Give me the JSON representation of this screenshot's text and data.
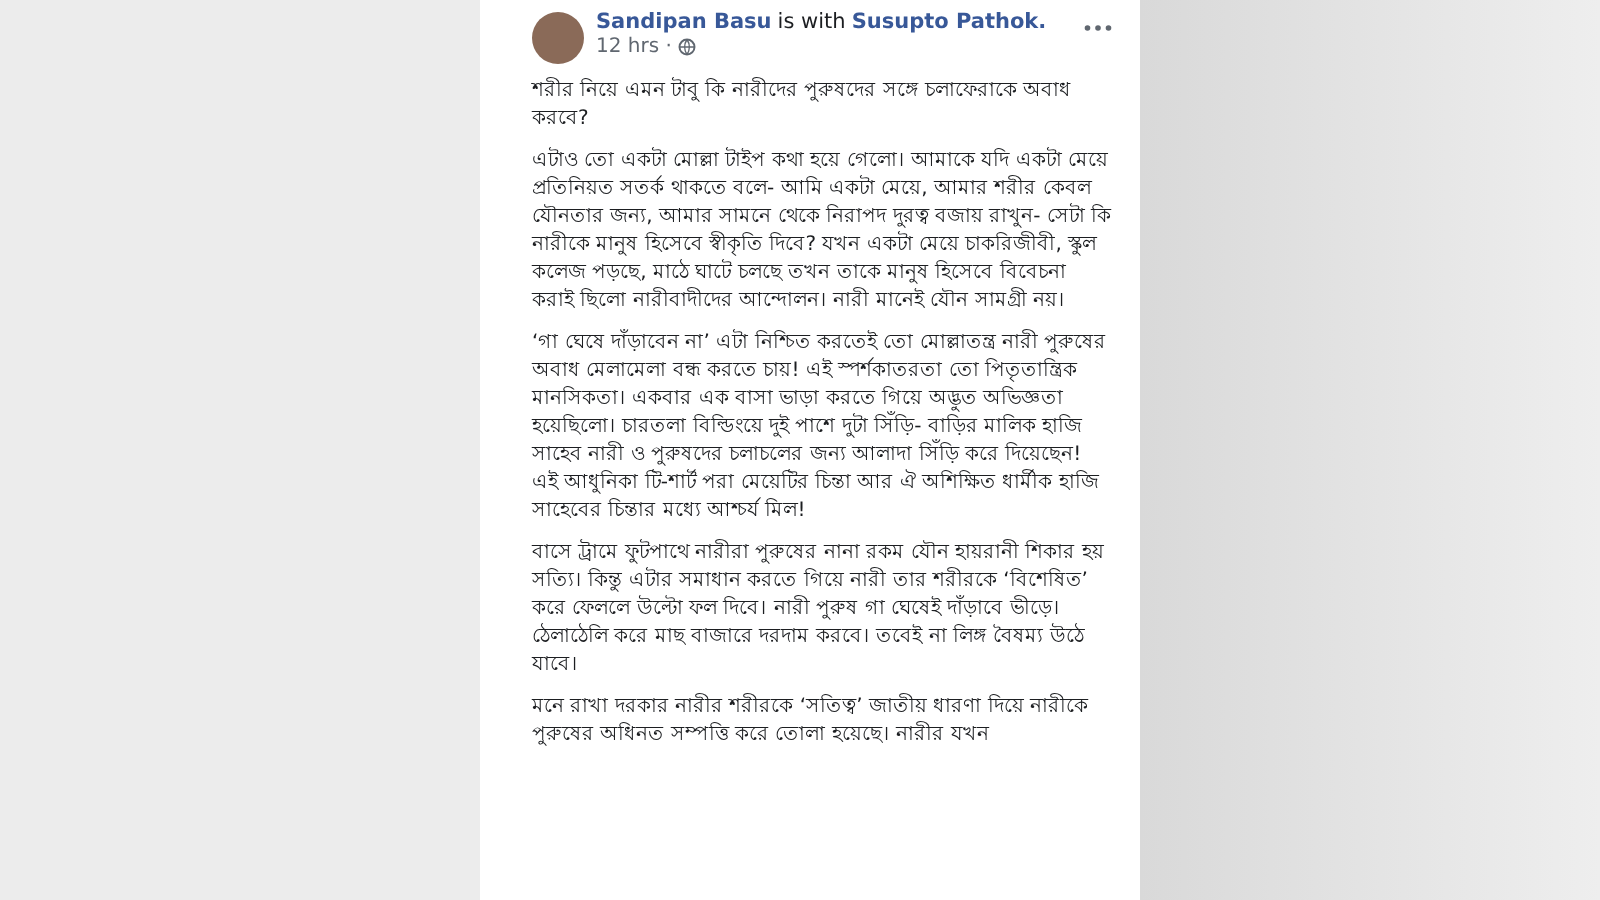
{
  "post": {
    "author": "Sandipan Basu",
    "with_text": "is with",
    "tagged": "Susupto Pathok.",
    "time": "12 hrs ·",
    "paragraphs": [
      "শরীর নিয়ে এমন টাবু কি নারীদের পুরুষদের সঙ্গে চলাফেরাকে অবাধ করবে?",
      "এটাও তো একটা মোল্লা টাইপ কথা হয়ে গেলো। আমাকে যদি একটা মেয়ে প্রতিনিয়ত সতর্ক থাকতে বলে- আমি একটা মেয়ে, আমার শরীর কেবল যৌনতার জন্য, আমার সামনে থেকে নিরাপদ দুরত্ব বজায় রাখুন- সেটা কি নারীকে মানুষ হিসেবে স্বীকৃতি দিবে? যখন একটা মেয়ে চাকরিজীবী, স্কুল কলেজ পড়ছে, মাঠে ঘাটে চলছে তখন তাকে মানুষ হিসেবে বিবেচনা করাই ছিলো নারীবাদীদের আন্দোলন। নারী মানেই যৌন সামগ্রী নয়।",
      "‘গা ঘেষে দাঁড়াবেন না’ এটা নিশ্চিত করতেই তো মোল্লাতন্ত্র নারী পুরুষের অবাধ মেলামেলা বন্ধ করতে চায়! এই স্পর্শকাতরতা তো পিতৃতান্ত্রিক মানসিকতা। একবার এক বাসা ভাড়া করতে গিয়ে অদ্ভুত অভিজ্ঞতা হয়েছিলো। চারতলা বিল্ডিংয়ে দুই পাশে দুটা সিঁড়ি- বাড়ির মালিক হাজি সাহেব নারী ও পুরুষদের চলাচলের জন্য আলাদা সিঁড়ি করে দিয়েছেন! এই আধুনিকা টি-শার্ট পরা মেয়েটির চিন্তা আর ঐ অশিক্ষিত ধার্মীক হাজি সাহেবের চিন্তার মধ্যে আশ্চর্য মিল!",
      "বাসে ট্রামে ফুটপাথে নারীরা পুরুষের নানা রকম যৌন হায়রানী শিকার হয় সত্যি। কিন্তু এটার সমাধান করতে গিয়ে নারী তার শরীরকে ‘বিশেষিত’ করে ফেললে উল্টো ফল দিবে। নারী পুরুষ গা ঘেষেই দাঁড়াবে ভীড়ে। ঠেলাঠেলি করে মাছ বাজারে দরদাম করবে। তবেই না লিঙ্গ বৈষম্য উঠে যাবে।",
      "মনে রাখা দরকার নারীর শরীরকে ‘সতিত্ব’ জাতীয় ধারণা দিয়ে নারীকে পুরুষের অধিনত সম্পত্তি করে তোলা হয়েছে। নারীর যখন"
    ]
  }
}
